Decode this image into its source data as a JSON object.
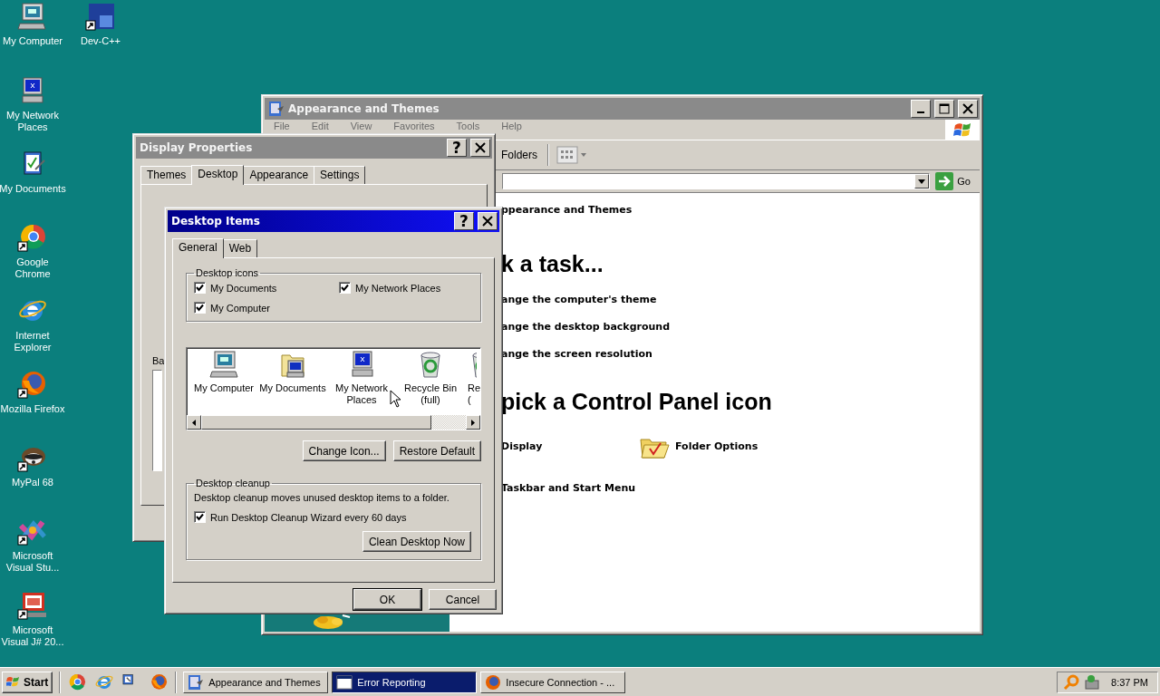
{
  "desktop": {
    "icons": [
      {
        "label": "My Computer"
      },
      {
        "label": "Dev-C++"
      },
      {
        "label": "My Network Places"
      },
      {
        "label": "My Documents"
      },
      {
        "label": "Google Chrome"
      },
      {
        "label": "Internet Explorer"
      },
      {
        "label": "Mozilla Firefox"
      },
      {
        "label": "MyPal 68"
      },
      {
        "label": "Microsoft Visual Stu..."
      },
      {
        "label": "Microsoft Visual J# 20..."
      }
    ]
  },
  "explorer_window": {
    "title": "Appearance and Themes",
    "menu": [
      "File",
      "Edit",
      "View",
      "Favorites",
      "Tools",
      "Help"
    ],
    "toolbar": {
      "folders": "Folders"
    },
    "address_bar": {
      "go": "Go"
    },
    "content": {
      "header": "ppearance and Themes",
      "task_heading": "k a task...",
      "tasks": [
        "ange the computer's theme",
        "ange the desktop background",
        "ange the screen resolution"
      ],
      "icon_heading": "pick a Control Panel icon",
      "icons": [
        {
          "label": "Display"
        },
        {
          "label": "Folder Options"
        },
        {
          "label": "Taskbar and Start Menu"
        }
      ]
    }
  },
  "display_properties": {
    "title": "Display Properties",
    "help_button": "?",
    "tabs": [
      {
        "label": "Themes",
        "selected": false
      },
      {
        "label": "Desktop",
        "selected": true
      },
      {
        "label": "Appearance",
        "selected": false
      },
      {
        "label": "Settings",
        "selected": false
      }
    ],
    "background_label": "Ba"
  },
  "desktop_items": {
    "title": "Desktop Items",
    "help_button": "?",
    "tabs": [
      {
        "label": "General",
        "selected": true
      },
      {
        "label": "Web",
        "selected": false
      }
    ],
    "desktop_icons": {
      "title": "Desktop icons",
      "options": [
        {
          "label": "My Documents",
          "checked": true
        },
        {
          "label": "My Network Places",
          "checked": true
        },
        {
          "label": "My Computer",
          "checked": true
        }
      ]
    },
    "icon_list": [
      {
        "label": "My Computer",
        "clipped": false
      },
      {
        "label": "My Documents",
        "clipped": false
      },
      {
        "label": "My Network Places",
        "clipped": false
      },
      {
        "label": "Recycle Bin (full)",
        "clipped": false
      },
      {
        "label": "Re (",
        "clipped": true
      }
    ],
    "buttons": [
      "Change Icon...",
      "Restore Default"
    ],
    "cleanup": {
      "title": "Desktop cleanup",
      "description": "Desktop cleanup moves unused desktop items to a folder.",
      "option": {
        "label": "Run Desktop Cleanup Wizard every 60 days",
        "checked": true
      },
      "button": "Clean Desktop Now"
    },
    "ok": "OK",
    "cancel": "Cancel"
  },
  "taskbar": {
    "start": "Start",
    "tasks": [
      {
        "label": "Appearance and Themes",
        "selected": false
      },
      {
        "label": "Error Reporting",
        "selected": true
      },
      {
        "label": "Insecure Connection - ...",
        "selected": false
      }
    ],
    "clock": "8:37 PM"
  }
}
